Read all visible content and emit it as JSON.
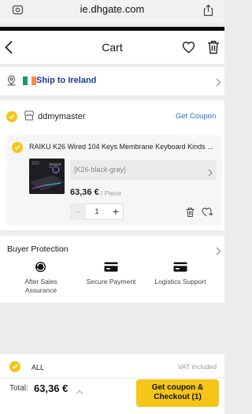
{
  "browser": {
    "url": "ie.dhgate.com"
  },
  "header": {
    "title": "Cart"
  },
  "shipping": {
    "label": "Ship to Ireland",
    "flag_colors": [
      "#169b62",
      "#ffffff",
      "#ff883e"
    ]
  },
  "store": {
    "name": "ddmymaster",
    "coupon_link": "Get Coupon",
    "item": {
      "title": "RAIKU K26 Wired 104 Keys Membrane Keyboard Kinds ...",
      "variant": "[K26-black-gray]",
      "price": "63,36 €",
      "unit": "/ Piece",
      "minus": "-",
      "quantity": "1",
      "plus": "+"
    }
  },
  "buyer_protection": {
    "title": "Buyer Protection",
    "features": [
      {
        "label": "After Sales Assurance",
        "icon": "after-sales-icon"
      },
      {
        "label": "Secure Payment",
        "icon": "card-icon"
      },
      {
        "label": "Logistics Support",
        "icon": "card-icon"
      }
    ]
  },
  "footer": {
    "select_all": "ALL",
    "vat": "VAT included",
    "total_label": "Total:",
    "total_value": "63,36 €",
    "checkout": "Get coupon & Checkout (1)"
  },
  "colors": {
    "accent": "#f5c518",
    "link": "#2b6ecf",
    "ship_text": "#1a3b8f"
  }
}
